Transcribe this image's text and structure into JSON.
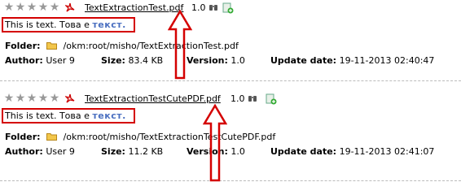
{
  "results": [
    {
      "title": "TextExtractionTest.pdf",
      "version": "1.0",
      "snippet_plain": "This is text. Това е ",
      "snippet_highlight": "текст.",
      "folder_label": "Folder:",
      "folder_path": "/okm:root/misho/TextExtractionTest.pdf",
      "author_label": "Author:",
      "author": "User 9",
      "size_label": "Size:",
      "size": "83.4 KB",
      "version_label": "Version:",
      "version_value": "1.0",
      "update_label": "Update date:",
      "update_date": "19-11-2013 02:40:47"
    },
    {
      "title": "TextExtractionTestCutePDF.pdf",
      "version": "1.0",
      "snippet_plain": "This is text. Това е ",
      "snippet_highlight": "текст.",
      "folder_label": "Folder:",
      "folder_path": "/okm:root/misho/TextExtractionTestCutePDF.pdf",
      "author_label": "Author:",
      "author": "User 9",
      "size_label": "Size:",
      "size": "11.2 KB",
      "version_label": "Version:",
      "version_value": "1.0",
      "update_label": "Update date:",
      "update_date": "19-11-2013 02:41:07"
    }
  ],
  "colors": {
    "annotation_red": "#d40000",
    "highlight_blue": "#4a6fc0",
    "star_gray": "#999999"
  },
  "icons": {
    "rating": "star-icon",
    "file": "pdf-file-icon",
    "preview": "binoculars-icon",
    "add": "add-to-list-icon",
    "folder": "folder-icon"
  }
}
